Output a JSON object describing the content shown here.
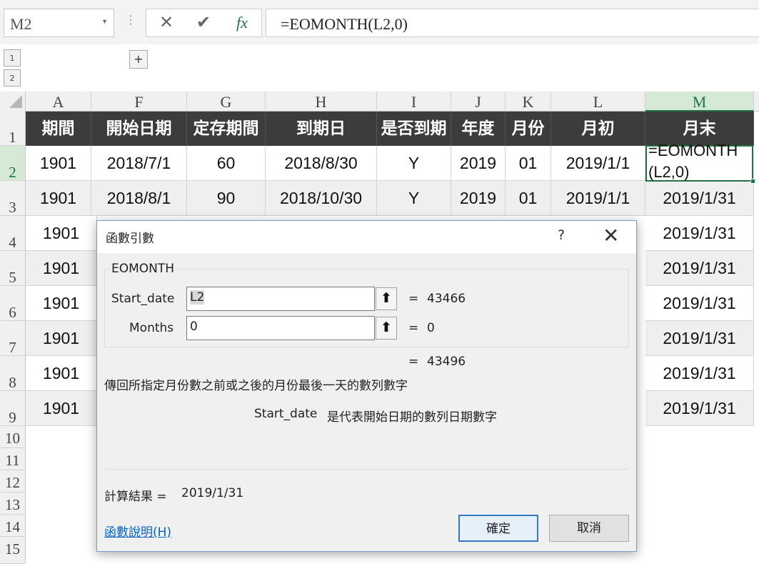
{
  "formula_bar": {
    "name_box": "M2",
    "cancel_icon": "✕",
    "enter_icon": "✔",
    "fx_icon": "fx",
    "formula": "=EOMONTH(L2,0)"
  },
  "outline": {
    "levels": [
      "1",
      "2"
    ],
    "expand": "+"
  },
  "columns": [
    "A",
    "F",
    "G",
    "H",
    "I",
    "J",
    "K",
    "L",
    "M"
  ],
  "selected_column": "M",
  "row_numbers": [
    "1",
    "2",
    "3",
    "4",
    "5",
    "6",
    "7",
    "8",
    "9",
    "10",
    "11",
    "12",
    "13",
    "14",
    "15"
  ],
  "header_row": [
    "期間",
    "開始日期",
    "定存期間",
    "到期日",
    "是否到期",
    "年度",
    "月份",
    "月初",
    "月末"
  ],
  "rows": [
    [
      "1901",
      "2018/7/1",
      "60",
      "2018/8/30",
      "Y",
      "2019",
      "01",
      "2019/1/1",
      ""
    ],
    [
      "1901",
      "2018/8/1",
      "90",
      "2018/10/30",
      "Y",
      "2019",
      "01",
      "2019/1/1",
      "2019/1/31"
    ],
    [
      "1901",
      "",
      "",
      "",
      "",
      "",
      "",
      "",
      "2019/1/31"
    ],
    [
      "1901",
      "",
      "",
      "",
      "",
      "",
      "",
      "",
      "2019/1/31"
    ],
    [
      "1901",
      "",
      "",
      "",
      "",
      "",
      "",
      "",
      "2019/1/31"
    ],
    [
      "1901",
      "",
      "",
      "",
      "",
      "",
      "",
      "",
      "2019/1/31"
    ],
    [
      "1901",
      "",
      "",
      "",
      "",
      "",
      "",
      "",
      "2019/1/31"
    ],
    [
      "1901",
      "",
      "",
      "",
      "",
      "",
      "",
      "",
      "2019/1/31"
    ]
  ],
  "active_cell": {
    "line1": "=EOMONTH",
    "line2": "(L2,0)"
  },
  "dialog": {
    "title": "函數引數",
    "help": "?",
    "close": "✕",
    "function_name": "EOMONTH",
    "args": [
      {
        "label": "Start_date",
        "value": "L2",
        "result": "43466"
      },
      {
        "label": "Months",
        "value": "0",
        "result": "0"
      }
    ],
    "equals": "=",
    "function_result": "43496",
    "description": "傳回所指定月份數之前或之後的月份最後一天的數列數字",
    "arg_desc_name": "Start_date",
    "arg_desc_text": "是代表開始日期的數列日期數字",
    "result_label": "計算結果 =",
    "result_value": "2019/1/31",
    "help_link": "函數說明(H)",
    "ok": "確定",
    "cancel": "取消",
    "ref_icon": "⬆"
  }
}
